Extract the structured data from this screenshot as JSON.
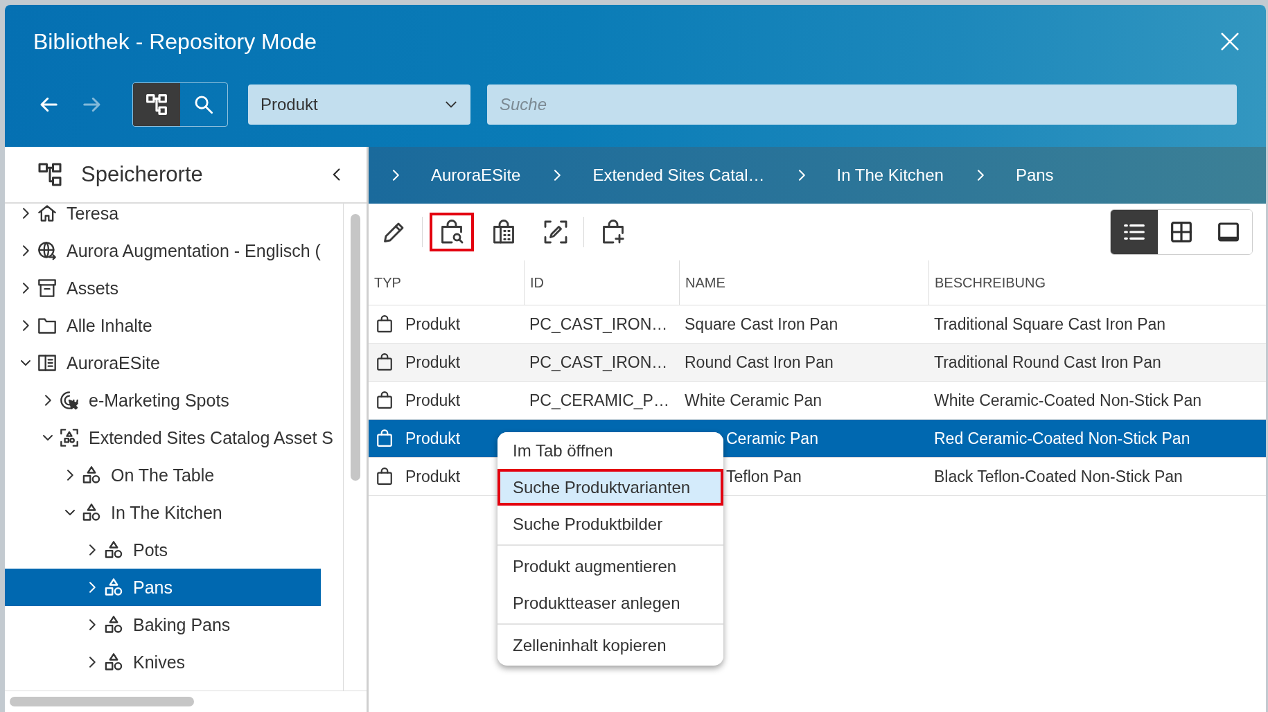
{
  "window": {
    "title": "Bibliothek - Repository Mode"
  },
  "nav": [
    {
      "kind": "back",
      "disabled": false
    },
    {
      "kind": "forward",
      "disabled": true
    }
  ],
  "mode_toggle": [
    {
      "kind": "tree",
      "selected": true
    },
    {
      "kind": "search",
      "selected": false
    }
  ],
  "type_select": {
    "value": "Produkt"
  },
  "search": {
    "placeholder": "Suche"
  },
  "sidebar": {
    "title": "Speicherorte",
    "tree": [
      {
        "label": "Teresa",
        "kind": "home",
        "expanded": false,
        "selected": false
      },
      {
        "label": "Aurora Augmentation - Englisch (",
        "kind": "globe",
        "expanded": false,
        "selected": false
      },
      {
        "label": "Assets",
        "kind": "archive",
        "expanded": false,
        "selected": false
      },
      {
        "label": "Alle Inhalte",
        "kind": "folder",
        "expanded": false,
        "selected": false
      },
      {
        "label": "AuroraESite",
        "kind": "site",
        "expanded": true,
        "selected": false,
        "children": [
          {
            "label": "e-Marketing Spots",
            "kind": "spots",
            "expanded": false,
            "selected": false
          },
          {
            "label": "Extended Sites Catalog Asset S",
            "kind": "catalog",
            "expanded": true,
            "selected": false,
            "children": [
              {
                "label": "On The Table",
                "kind": "category",
                "expanded": false,
                "selected": false
              },
              {
                "label": "In The Kitchen",
                "kind": "category",
                "expanded": true,
                "selected": false,
                "children": [
                  {
                    "label": "Pots",
                    "kind": "category",
                    "expanded": false,
                    "selected": false
                  },
                  {
                    "label": "Pans",
                    "kind": "category",
                    "expanded": false,
                    "selected": true
                  },
                  {
                    "label": "Baking Pans",
                    "kind": "category",
                    "expanded": false,
                    "selected": false
                  },
                  {
                    "label": "Knives",
                    "kind": "category",
                    "expanded": false,
                    "selected": false
                  }
                ]
              }
            ]
          }
        ]
      }
    ]
  },
  "breadcrumbs": [
    {
      "label": "AuroraESite"
    },
    {
      "label": "Extended Sites Catal…"
    },
    {
      "label": "In The Kitchen"
    },
    {
      "label": "Pans"
    }
  ],
  "toolbar": {
    "groups": [
      {
        "actions": [
          {
            "kind": "edit",
            "highlighted": false
          }
        ]
      },
      {
        "actions": [
          {
            "kind": "find-variants",
            "highlighted": true
          },
          {
            "kind": "find-images",
            "highlighted": false
          },
          {
            "kind": "augment",
            "highlighted": false
          }
        ]
      },
      {
        "actions": [
          {
            "kind": "create-teaser",
            "highlighted": false
          }
        ]
      }
    ],
    "views": [
      {
        "kind": "list",
        "selected": true
      },
      {
        "kind": "grid",
        "selected": false
      },
      {
        "kind": "single",
        "selected": false
      }
    ]
  },
  "table": {
    "columns": [
      "TYP",
      "ID",
      "NAME",
      "BESCHREIBUNG"
    ],
    "rows": [
      {
        "type": "Produkt",
        "id": "PC_CAST_IRON…",
        "name": "Square Cast Iron Pan",
        "description": "Traditional Square Cast Iron Pan",
        "selected": false
      },
      {
        "type": "Produkt",
        "id": "PC_CAST_IRON…",
        "name": "Round Cast Iron Pan",
        "description": "Traditional Round Cast Iron Pan",
        "selected": false
      },
      {
        "type": "Produkt",
        "id": "PC_CERAMIC_P…",
        "name": "White Ceramic Pan",
        "description": "White Ceramic-Coated Non-Stick Pan",
        "selected": false
      },
      {
        "type": "Produkt",
        "name": "Ceramic Pan",
        "description": "Red Ceramic-Coated Non-Stick Pan",
        "selected": true
      },
      {
        "type": "Produkt",
        "name": "Teflon Pan",
        "description": "Black Teflon-Coated Non-Stick Pan",
        "selected": false
      }
    ]
  },
  "context_menu": {
    "groups": [
      {
        "items": [
          {
            "label": "Im Tab öffnen",
            "selected": false,
            "highlighted": false
          },
          {
            "label": "Suche Produktvarianten",
            "selected": true,
            "highlighted": true
          },
          {
            "label": "Suche Produktbilder",
            "selected": false,
            "highlighted": false
          }
        ]
      },
      {
        "items": [
          {
            "label": "Produkt augmentieren",
            "selected": false,
            "highlighted": false
          },
          {
            "label": "Produktteaser anlegen",
            "selected": false,
            "highlighted": false
          }
        ]
      },
      {
        "items": [
          {
            "label": "Zelleninhalt kopieren",
            "selected": false,
            "highlighted": false
          }
        ]
      }
    ]
  }
}
